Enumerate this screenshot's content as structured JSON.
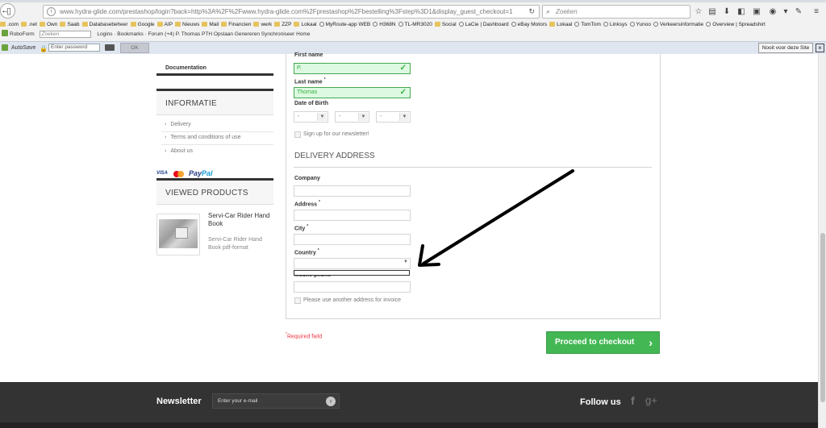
{
  "browser": {
    "url": "www.hydra-glide.com/prestashop/login?back=http%3A%2F%2Fwww.hydra-glide.com%2Fprestashop%2Fbestelling%3Fstep%3D1&display_guest_checkout=1",
    "search_placeholder": "Zoeken",
    "bookmarks": [
      ".com",
      ".net",
      "Own",
      "Saab",
      "Databasebeheer",
      "Google",
      "AIP",
      "Nieuws",
      "Mail",
      "Financien",
      "werk",
      "ZZP",
      "Lokaal",
      "MyRoute-app WEB",
      "H368N",
      "TL-MR3020",
      "Social",
      "LaCie | Dashboard",
      "eBay Motors",
      "Lokaal",
      "TomTom",
      "Linksys",
      "Yunoo",
      "Verkeersinformatie",
      "Overview | Spreadshirt"
    ],
    "robo_items": [
      "RoboForm",
      "Zoeken",
      "Logins",
      "Bookmarks",
      "Forum (+4)",
      "P. Thomas",
      "PTH",
      "Opslaan",
      "Genereren",
      "Synchroniseer",
      "Home"
    ],
    "autosave": {
      "label": "AutoSave",
      "password_placeholder": "Enter password",
      "ok_label": "OK",
      "never_label": "Nooit voor deze Site"
    }
  },
  "sidebar": {
    "documentation": "Documentation",
    "info_title": "INFORMATIE",
    "info_links": [
      "Delivery",
      "Terms and conditions of use",
      "About us"
    ],
    "payment": {
      "visa": "VISA",
      "paypal_a": "Pay",
      "paypal_b": "Pal"
    },
    "viewed_title": "VIEWED PRODUCTS",
    "product_title": "Servi-Car Rider Hand Book",
    "product_desc": "Servi-Car Rider Hand Book pdf-format"
  },
  "form": {
    "first_name_label": "First name",
    "first_name_value": "P.",
    "last_name_label": "Last name",
    "last_name_value": "Thomas",
    "dob_label": "Date of Birth",
    "dob_selects": [
      "-",
      "-",
      "-"
    ],
    "newsletter_label": "Sign up for our newsletter!",
    "delivery_title": "DELIVERY ADDRESS",
    "company_label": "Company",
    "address_label": "Address",
    "city_label": "City",
    "country_label": "Country",
    "mobile_label": "Mobile phone",
    "invoice_label": "Please use another address for invoice",
    "required_label": "Required field",
    "checkout_label": "Proceed to checkout"
  },
  "footer": {
    "newsletter_label": "Newsletter",
    "email_placeholder": "Enter your e-mail",
    "follow_label": "Follow us"
  },
  "colors": {
    "green_button": "#43b754",
    "footer_bg": "#333333",
    "required_red": "#f13340"
  }
}
